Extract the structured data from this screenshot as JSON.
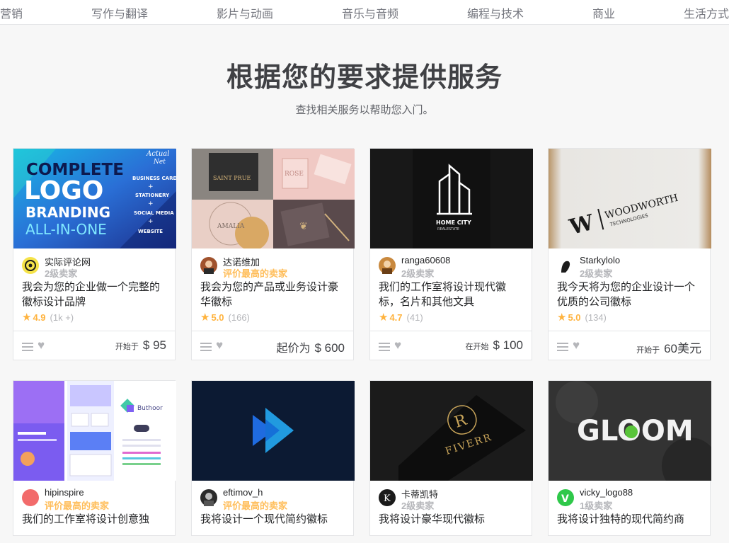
{
  "nav": {
    "items": [
      "营销",
      "写作与翻译",
      "影片与动画",
      "音乐与音频",
      "编程与技术",
      "商业",
      "生活方式"
    ]
  },
  "hero": {
    "title": "根据您的要求提供服务",
    "subtitle": "查找相关服务以帮助您入门。"
  },
  "gigs": [
    {
      "seller": "实际评论网",
      "level": "2级卖家",
      "top": false,
      "title": "我会为您的企业做一个完整的徽标设计品牌",
      "rating": "4.9",
      "reviews": "(1k +)",
      "price_label": "开始于",
      "price": "$ 95",
      "thumb_text": {
        "line1": "COMPLETE",
        "line2": "LOGO",
        "line3": "BRANDING",
        "line4": "ALL-IN-ONE",
        "side1": "BUSINESS CARD",
        "side2": "STATIONERY",
        "side3": "SOCIAL MEDIA",
        "side4": "WEBSITE",
        "badge1": "Actual",
        "badge2": "Net"
      }
    },
    {
      "seller": "达诺维加",
      "level": "评价最高的卖家",
      "top": true,
      "title": "我会为您的产品或业务设计豪华徽标",
      "rating": "5.0",
      "reviews": "(166)",
      "price_label": "起价为",
      "price": "$ 600",
      "thumb_text": {
        "a": "SAINT PRUE",
        "b": "ROSE",
        "c": "AMALIA"
      }
    },
    {
      "seller": "ranga60608",
      "level": "2级卖家",
      "top": false,
      "title": "我们的工作室将设计现代徽标，名片和其他文具",
      "rating": "4.7",
      "reviews": "(41)",
      "price_label": "在开始",
      "price": "$ 100",
      "thumb_text": {
        "name": "HOME CITY",
        "sub": "REALESTATE"
      }
    },
    {
      "seller": "Starkylolo",
      "level": "2级卖家",
      "top": false,
      "title": "我今天将为您的企业设计一个优质的公司徽标",
      "rating": "5.0",
      "reviews": "(134)",
      "price_label": "开始于",
      "price": "60美元",
      "thumb_text": {
        "mark": "W",
        "name": "WOODWORTH",
        "sub": "TECHNOLOGIES"
      }
    },
    {
      "seller": "hipinspire",
      "level": "评价最高的卖家",
      "top": true,
      "title": "我们的工作室将设计创意独",
      "thumb_text": {
        "brand": "Buthoor"
      }
    },
    {
      "seller": "eftimov_h",
      "level": "评价最高的卖家",
      "top": true,
      "title": "我将设计一个现代简约徽标"
    },
    {
      "seller": "卡蒂凯特",
      "level": "2级卖家",
      "top": false,
      "title": "我将设计豪华现代徽标",
      "thumb_text": {
        "word": "FIVERR"
      }
    },
    {
      "seller": "vicky_logo88",
      "level": "1级卖家",
      "top": false,
      "title": "我将设计独特的现代简约商",
      "thumb_text": {
        "word": "GLOOM"
      }
    }
  ],
  "colors": {
    "top_rated": "#ffbe5b",
    "star": "#ffb33e",
    "muted": "#b5b6ba"
  }
}
